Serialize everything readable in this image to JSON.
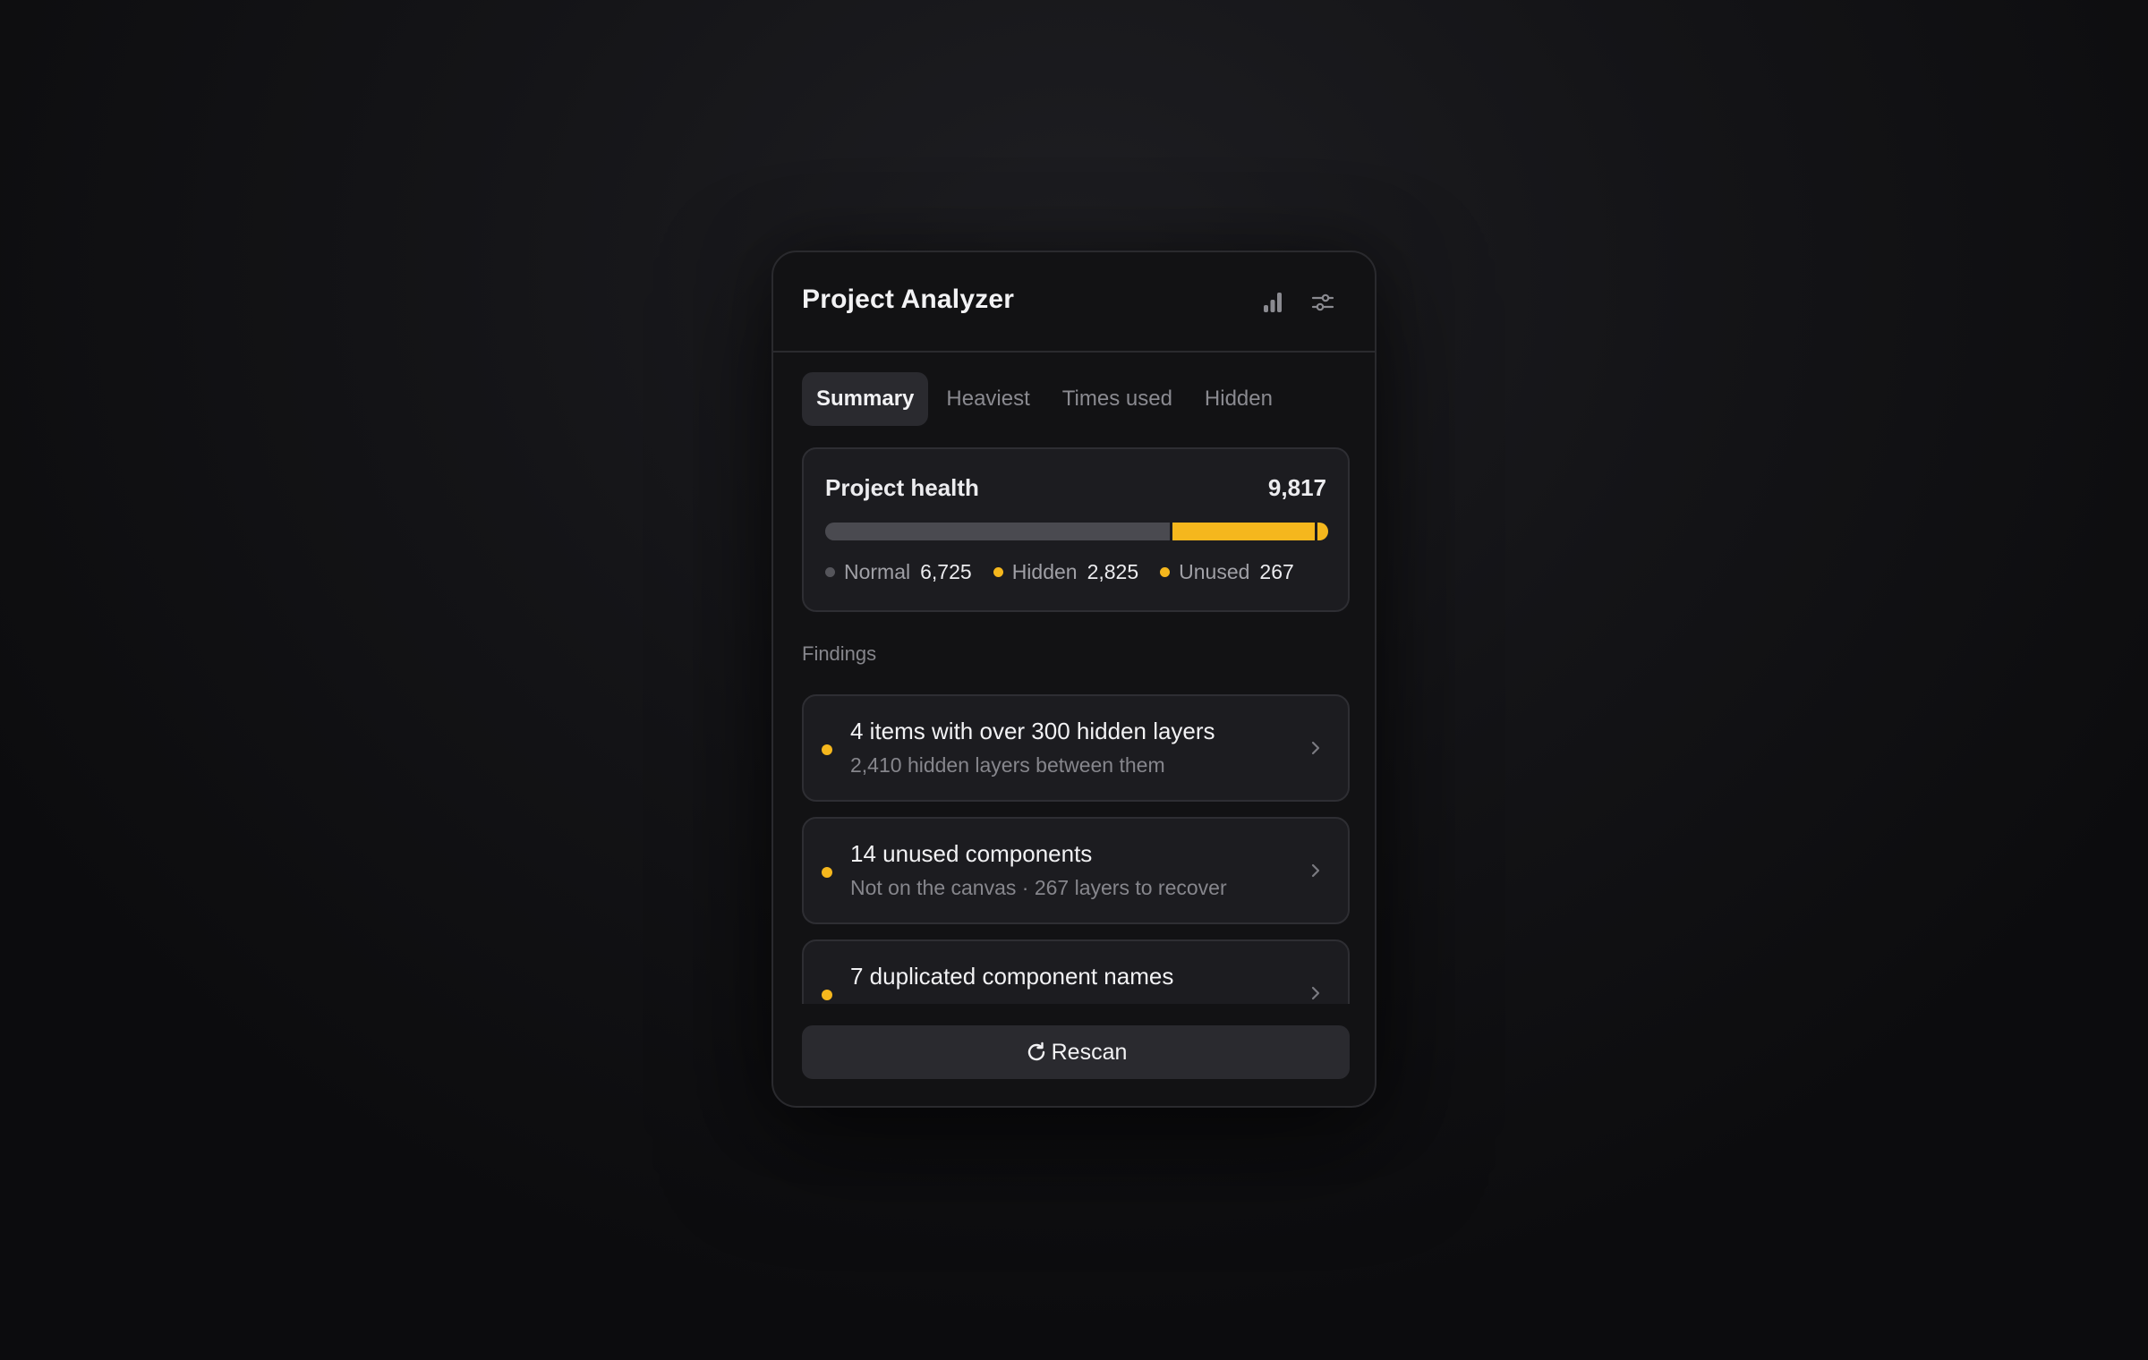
{
  "app": {
    "title": "Project Analyzer"
  },
  "header": {
    "icons": [
      "bar-chart-icon",
      "sliders-icon"
    ]
  },
  "tabs": [
    {
      "label": "Summary",
      "active": true
    },
    {
      "label": "Heaviest",
      "active": false
    },
    {
      "label": "Times used",
      "active": false
    },
    {
      "label": "Hidden",
      "active": false
    }
  ],
  "health": {
    "title": "Project health",
    "total": "9,817",
    "legend": [
      {
        "label": "Normal",
        "value": "6,725",
        "color": "#55555b"
      },
      {
        "label": "Hidden",
        "value": "2,825",
        "color": "#f5b71d"
      },
      {
        "label": "Unused",
        "value": "267",
        "color": "#f5b71d"
      }
    ],
    "bar_values": [
      6725,
      2825,
      267
    ]
  },
  "findings": {
    "label": "Findings",
    "items": [
      {
        "title": "4 items with over 300 hidden layers",
        "subtitle": "2,410 hidden layers between them",
        "dot_color": "#f5b71d"
      },
      {
        "title": "14 unused components",
        "subtitle": "Not on the canvas · 267 layers to recover",
        "dot_color": "#f5b71d"
      },
      {
        "title": "7 duplicated component names",
        "subtitle": "",
        "dot_color": "#f5b71d"
      }
    ]
  },
  "actions": {
    "rescan_label": "Rescan"
  },
  "colors": {
    "accent": "#f5b71d",
    "background": "#121214"
  }
}
